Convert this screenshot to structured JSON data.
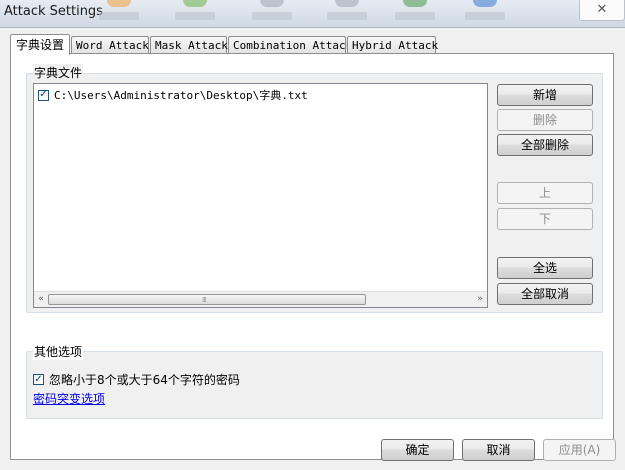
{
  "window": {
    "title": "Attack Settings",
    "close_glyph": "✕"
  },
  "tabs": [
    {
      "label": "字典设置"
    },
    {
      "label": "Word Attack"
    },
    {
      "label": "Mask Attack"
    },
    {
      "label": "Combination Attack"
    },
    {
      "label": "Hybrid Attack"
    }
  ],
  "dictionary": {
    "group_label": "字典文件",
    "items": [
      {
        "path": "C:\\Users\\Administrator\\Desktop\\字典.txt",
        "checked": true
      }
    ],
    "buttons": {
      "add": "新增",
      "delete": "删除",
      "delete_all": "全部删除",
      "up": "上",
      "down": "下",
      "select_all": "全选",
      "deselect_all": "全部取消"
    },
    "scroll_left": "«",
    "scroll_right": "»",
    "scroll_grip": "⁞⁞⁞"
  },
  "other": {
    "group_label": "其他选项",
    "ignore_option": {
      "label": "忽略小于8个或大于64个字符的密码",
      "checked": true
    },
    "mutation_link": "密码突变选项"
  },
  "footer": {
    "ok": "确定",
    "cancel": "取消",
    "apply": "应用(A)"
  },
  "check_glyph": "✓",
  "colors": {
    "link": "#0000ee",
    "disabled_text": "#8d8d8d",
    "list_border": "#828790"
  }
}
